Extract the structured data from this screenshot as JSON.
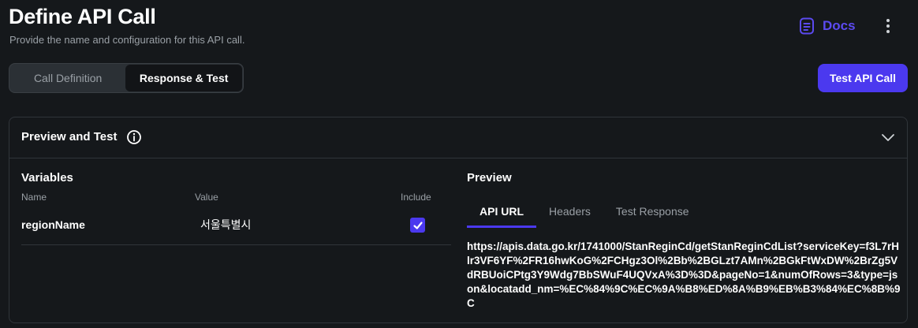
{
  "header": {
    "title": "Define API Call",
    "subtitle": "Provide the name and configuration for this API call.",
    "docs_label": "Docs"
  },
  "tabs": [
    {
      "label": "Call Definition",
      "active": false
    },
    {
      "label": "Response & Test",
      "active": true
    }
  ],
  "test_button_label": "Test API Call",
  "preview_card": {
    "title": "Preview and Test",
    "variables": {
      "title": "Variables",
      "columns": [
        "Name",
        "Value",
        "Include"
      ],
      "rows": [
        {
          "name": "regionName",
          "value": "서울특별시",
          "include": true
        }
      ]
    },
    "preview": {
      "title": "Preview",
      "tabs": [
        "API URL",
        "Headers",
        "Test Response"
      ],
      "active_tab": "API URL",
      "api_url": "https://apis.data.go.kr/1741000/StanReginCd/getStanReginCdList?serviceKey=f3L7rHlr3VF6YF%2FR16hwKoG%2FCHgz3Ol%2Bb%2BGLzt7AMn%2BGkFtWxDW%2BrZg5VdRBUoiCPtg3Y9Wdg7BbSWuF4UQVxA%3D%3D&pageNo=1&numOfRows=3&type=json&locatadd_nm=%EC%84%9C%EC%9A%B8%ED%8A%B9%EB%B3%84%EC%8B%9C"
    }
  },
  "colors": {
    "accent": "#4b39ef",
    "docs": "#5b4af0",
    "background": "#15181b",
    "border": "#30353a",
    "muted_text": "#9aa0a6"
  },
  "icons": [
    "docs-icon",
    "more-vertical-icon",
    "info-icon",
    "chevron-down-icon",
    "check-icon"
  ]
}
